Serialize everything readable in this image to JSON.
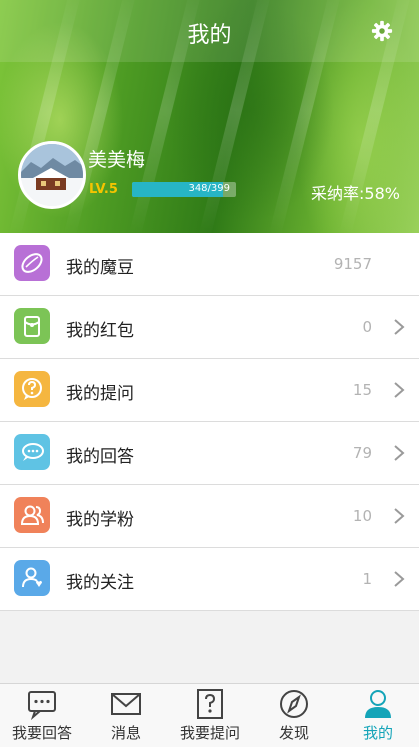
{
  "header": {
    "title": "我的"
  },
  "profile": {
    "username": "美美梅",
    "level": "LV.5",
    "xp_text": "348/399",
    "xp_progress": 0.872,
    "adopt_rate": "采纳率:58%"
  },
  "menu": [
    {
      "label": "我的魔豆",
      "count": "9157",
      "color": "#b870d6",
      "icon": "bean-icon",
      "chevron": false
    },
    {
      "label": "我的红包",
      "count": "0",
      "color": "#7cc456",
      "icon": "red-envelope-icon",
      "chevron": true
    },
    {
      "label": "我的提问",
      "count": "15",
      "color": "#f5b640",
      "icon": "question-icon",
      "chevron": true
    },
    {
      "label": "我的回答",
      "count": "79",
      "color": "#5fc3e4",
      "icon": "chat-icon",
      "chevron": true
    },
    {
      "label": "我的学粉",
      "count": "10",
      "color": "#f0825a",
      "icon": "fans-icon",
      "chevron": true
    },
    {
      "label": "我的关注",
      "count": "1",
      "color": "#5aa9e8",
      "icon": "follow-icon",
      "chevron": true
    }
  ],
  "tabs": [
    {
      "label": "我要回答",
      "icon": "answer-icon"
    },
    {
      "label": "消息",
      "icon": "mail-icon"
    },
    {
      "label": "我要提问",
      "icon": "ask-icon"
    },
    {
      "label": "发现",
      "icon": "compass-icon"
    },
    {
      "label": "我的",
      "icon": "profile-icon",
      "active": true
    }
  ],
  "colors": {
    "accent": "#14a4b8",
    "xp_bar": "#27b5c5",
    "level": "#f5c400"
  }
}
